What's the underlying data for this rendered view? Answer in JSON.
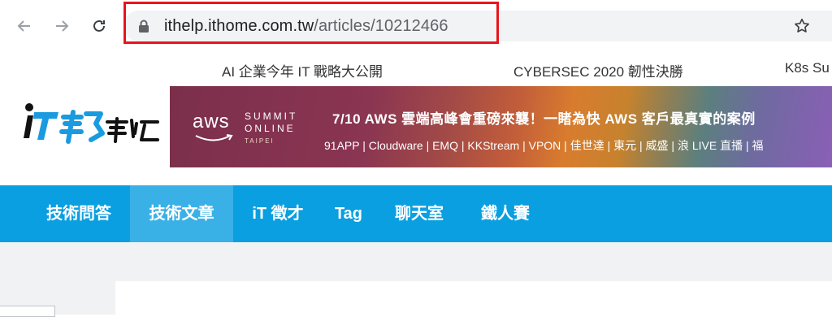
{
  "browser": {
    "url_host": "ithelp.ithome.com.tw",
    "url_path": "/articles/10212466"
  },
  "ticker": {
    "items": [
      "AI 企業今年 IT 戰略大公開",
      "CYBERSEC 2020 韌性決勝",
      "K8s Su"
    ]
  },
  "site": {
    "logo_text": "iT邦幫忙",
    "brand_color": "#0a9fe0"
  },
  "banner": {
    "brand": "aws",
    "event_line1": "SUMMIT",
    "event_line2": "ONLINE",
    "event_city": "TAIPEI",
    "headline": "7/10 AWS 雲端高峰會重磅來襲！一睹為快 AWS 客戶最真實的案例",
    "partners": "91APP | Cloudware | EMQ | KKStream | VPON | 佳世達 | 東元 | 威盛 | 浪 LIVE 直播 | 福"
  },
  "nav": {
    "items": [
      {
        "label": "技術問答"
      },
      {
        "label": "技術文章"
      },
      {
        "label": "iT 徵才"
      },
      {
        "label": "Tag"
      },
      {
        "label": "聊天室"
      },
      {
        "label": "鐵人賽"
      }
    ]
  }
}
